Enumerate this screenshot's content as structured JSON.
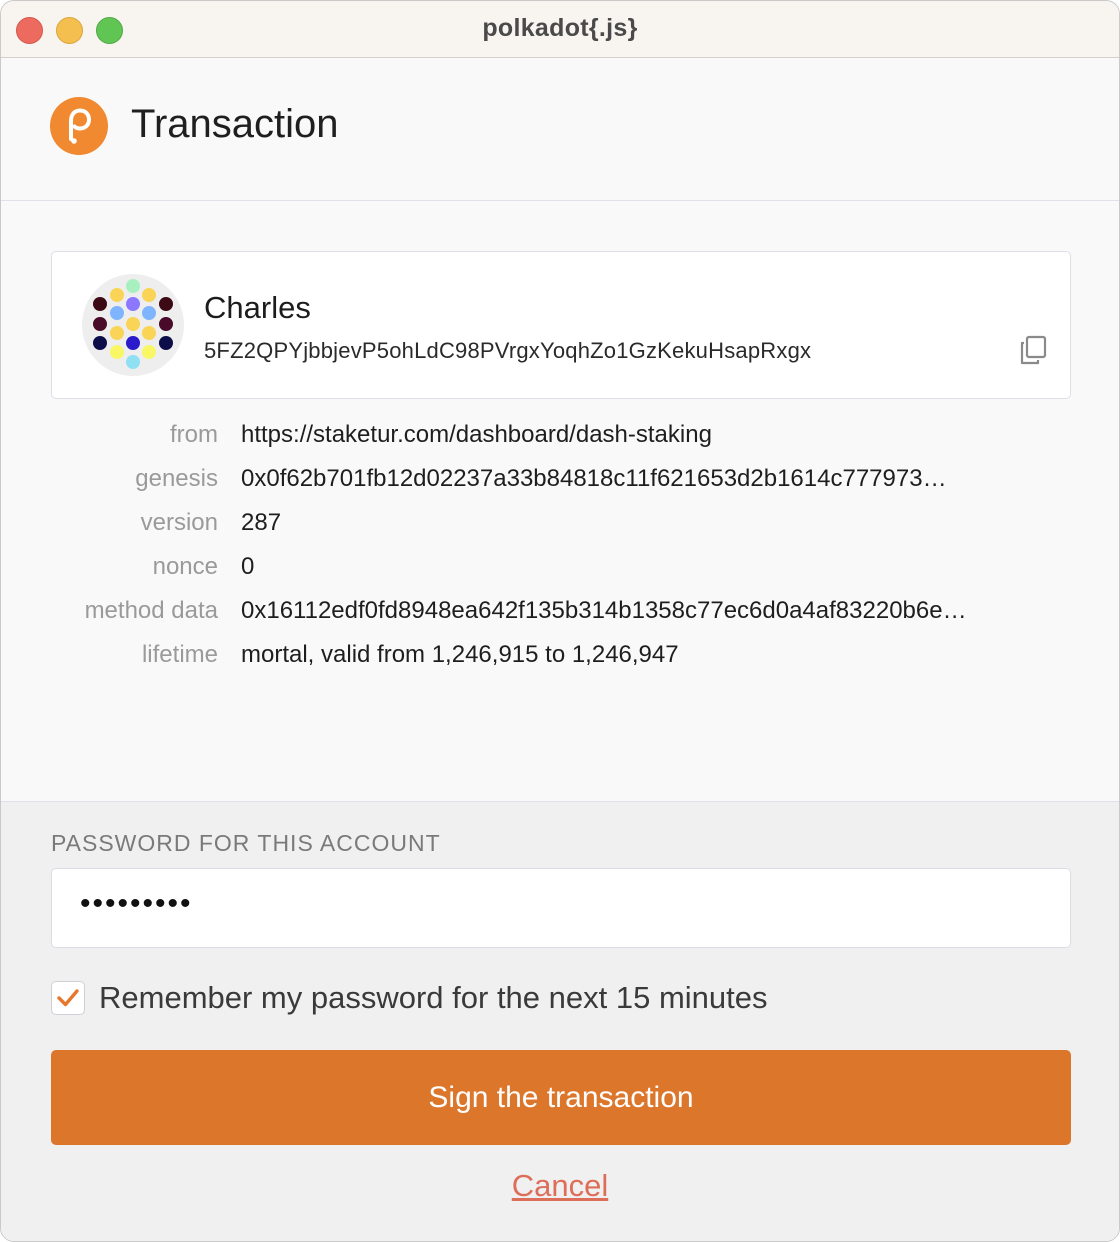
{
  "window": {
    "title": "polkadot{.js}"
  },
  "header": {
    "title": "Transaction"
  },
  "account": {
    "name": "Charles",
    "address": "5FZ2QPYjbbjevP5ohLdC98PVrgxYoqhZo1GzKekuHsapRxgx"
  },
  "details": [
    {
      "label": "from",
      "value": "https://staketur.com/dashboard/dash-staking"
    },
    {
      "label": "genesis",
      "value": "0x0f62b701fb12d02237a33b84818c11f621653d2b1614c777973…"
    },
    {
      "label": "version",
      "value": "287"
    },
    {
      "label": "nonce",
      "value": "0"
    },
    {
      "label": "method data",
      "value": "0x16112edf0fd8948ea642f135b314b1358c77ec6d0a4af83220b6e…"
    },
    {
      "label": "lifetime",
      "value": "mortal, valid from 1,246,915 to 1,246,947"
    }
  ],
  "password": {
    "label": "PASSWORD FOR THIS ACCOUNT",
    "value": "•••••••••"
  },
  "remember": {
    "label": "Remember my password for the next 15 minutes",
    "checked": true
  },
  "buttons": {
    "sign": "Sign the transaction",
    "cancel": "Cancel"
  },
  "colors": {
    "accent": "#dc762b",
    "cancel": "#dd6f5a",
    "checkmark": "#e8772e",
    "logo": "#f0892f"
  },
  "icons": [
    "polkadot-logo-icon",
    "identicon",
    "copy-icon",
    "checkmark-icon"
  ]
}
